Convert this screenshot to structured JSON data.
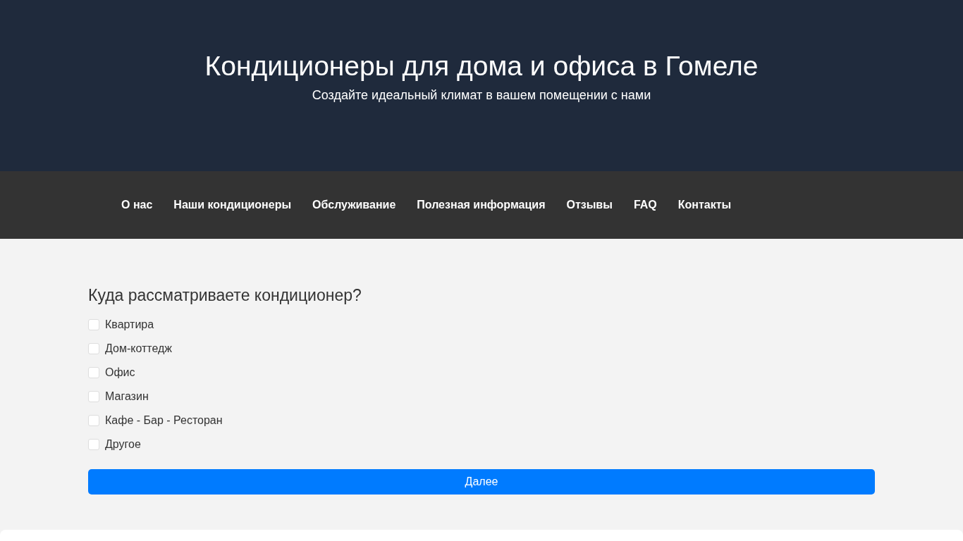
{
  "header": {
    "title": "Кондиционеры для дома и офиса в Гомеле",
    "subtitle": "Создайте идеальный климат в вашем помещении с нами"
  },
  "nav": [
    "О нас",
    "Наши кондиционеры",
    "Обслуживание",
    "Полезная информация",
    "Отзывы",
    "FAQ",
    "Контакты"
  ],
  "quiz": {
    "question": "Куда рассматриваете кондиционер?",
    "options": [
      {
        "label": "Квартира",
        "checked": false
      },
      {
        "label": "Дом-коттедж",
        "checked": false
      },
      {
        "label": "Офис",
        "checked": false
      },
      {
        "label": "Магазин",
        "checked": false
      },
      {
        "label": "Кафе - Бар - Ресторан",
        "checked": false
      },
      {
        "label": "Другое",
        "checked": false
      }
    ],
    "button": "Далее"
  }
}
